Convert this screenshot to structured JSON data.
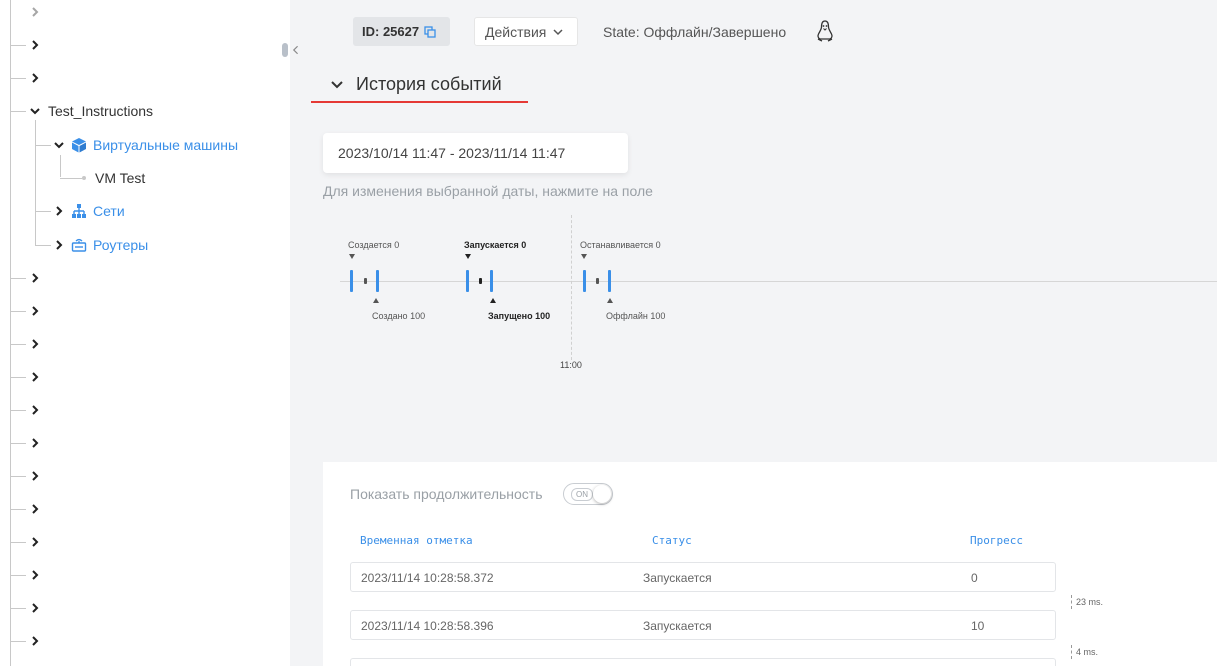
{
  "sidebar": {
    "items": [
      {
        "label": "Test_Instructions"
      },
      {
        "label": "Виртуальные машины"
      },
      {
        "label": "VM Test"
      },
      {
        "label": "Сети"
      },
      {
        "label": "Роутеры"
      }
    ]
  },
  "header": {
    "id_label": "ID: 25627",
    "actions_label": "Действия",
    "state_label": "State: Оффлайн/Завершено"
  },
  "section": {
    "title": "История событий"
  },
  "date_range": {
    "value": "2023/10/14 11:47 - 2023/11/14 11:47",
    "hint": "Для изменения выбранной даты, нажмите на поле"
  },
  "timeline": {
    "top_labels": [
      "Создается 0",
      "Запускается 0",
      "Останавливается 0"
    ],
    "bottom_labels": [
      "Создано 100",
      "Запущено 100",
      "Оффлайн 100"
    ],
    "time_label": "11:00"
  },
  "table": {
    "duration_label": "Показать продолжительность",
    "toggle_label": "ON",
    "headers": {
      "timestamp": "Временная отметка",
      "status": "Статус",
      "progress": "Прогресс"
    },
    "rows": [
      {
        "timestamp": "2023/11/14 10:28:58.372",
        "status": "Запускается",
        "progress": "0"
      },
      {
        "timestamp": "2023/11/14 10:28:58.396",
        "status": "Запускается",
        "progress": "10"
      }
    ],
    "durations": [
      "23 ms.",
      "4 ms."
    ]
  },
  "colors": {
    "accent": "#3a8fe8",
    "underline": "#e53935"
  }
}
